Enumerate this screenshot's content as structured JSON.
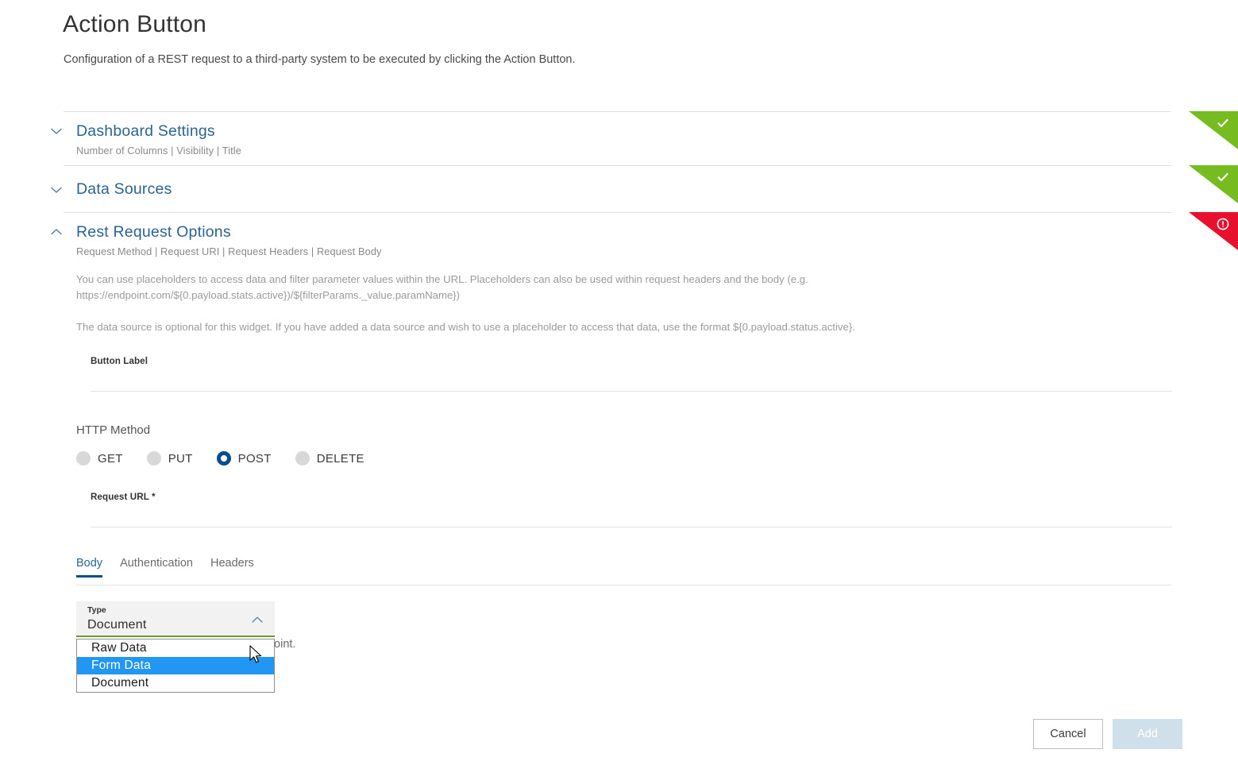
{
  "header": {
    "title": "Action Button",
    "subtitle": "Configuration of a REST request to a third-party system to be executed by clicking the Action Button."
  },
  "accordion": {
    "sections": [
      {
        "title": "Dashboard Settings",
        "summary": "Number of Columns | Visibility | Title",
        "expanded": false,
        "chevron_icon": "chevron-down-icon",
        "badge": {
          "type": "valid",
          "color": "#76bc21",
          "icon": "check-icon"
        }
      },
      {
        "title": "Data Sources",
        "summary": "",
        "expanded": false,
        "chevron_icon": "chevron-down-icon",
        "badge": {
          "type": "valid",
          "color": "#76bc21",
          "icon": "check-icon"
        }
      },
      {
        "title": "Rest Request Options",
        "summary": "Request Method | Request URI | Request Headers | Request Body",
        "expanded": true,
        "chevron_icon": "chevron-up-icon",
        "badge": {
          "type": "error",
          "color": "#e8112d",
          "icon": "error-exclamation-icon"
        }
      }
    ]
  },
  "rest_request": {
    "paragraph_1": "You can use placeholders to access data and filter parameter values within the URL. Placeholders can also be used within request headers and the body (e.g. https://endpoint.com/${0.payload.stats.active})/${filterParams._value.paramName})",
    "paragraph_2": "The data source is optional for this widget. If you have added a data source and wish to use a placeholder to access that data, use the format ${0.payload.status.active}.",
    "button_label_field": {
      "label": "Button Label",
      "value": "",
      "placeholder": ""
    },
    "http_method": {
      "label": "HTTP Method",
      "selected": "POST",
      "options": [
        "GET",
        "PUT",
        "POST",
        "DELETE"
      ]
    },
    "request_url_field": {
      "label": "Request URL *",
      "value": "",
      "placeholder": ""
    },
    "tabs": {
      "items": [
        "Body",
        "Authentication",
        "Headers"
      ],
      "active": "Body"
    },
    "type_select": {
      "label": "Type",
      "value": "Document",
      "open": true,
      "caret_icon": "chevron-up-icon",
      "options": [
        "Raw Data",
        "Form Data",
        "Document"
      ],
      "highlighted": "Form Data"
    },
    "occluded_text": "he HTTP endpoint."
  },
  "footer": {
    "cancel_label": "Cancel",
    "add_label": "Add"
  },
  "colors": {
    "link_blue": "#2a6496",
    "accent_blue": "#0a4d8c",
    "valid_green": "#76bc21",
    "error_red": "#e8112d",
    "select_underline_green": "#6f9a28",
    "option_highlight": "#2196f3"
  }
}
